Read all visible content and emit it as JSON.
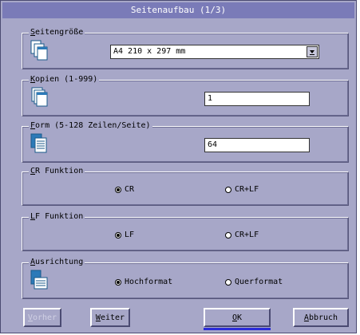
{
  "window": {
    "title": "Seitenaufbau (1/3)"
  },
  "groups": {
    "page_size": {
      "legend_key": "S",
      "legend_rest": "eitengröße",
      "dropdown_value": "A4 210 x 297 mm"
    },
    "copies": {
      "legend_key": "K",
      "legend_rest": "opien (1-999)",
      "value": "1"
    },
    "form": {
      "legend_key": "F",
      "legend_rest": "orm (5-128 Zeilen/Seite)",
      "value": "64"
    },
    "cr": {
      "legend_key": "C",
      "legend_rest": "R Funktion",
      "options": [
        {
          "label": "CR",
          "selected": true
        },
        {
          "label": "CR+LF",
          "selected": false
        }
      ]
    },
    "lf": {
      "legend_key": "L",
      "legend_rest": "F Funktion",
      "options": [
        {
          "label": "LF",
          "selected": true
        },
        {
          "label": "CR+LF",
          "selected": false
        }
      ]
    },
    "orientation": {
      "legend_key": "A",
      "legend_rest": "usrichtung",
      "options": [
        {
          "label": "Hochformat",
          "selected": true
        },
        {
          "label": "Querformat",
          "selected": false
        }
      ]
    }
  },
  "buttons": {
    "back": "Vorher",
    "next": "Weiter",
    "ok": "OK",
    "cancel": "Abbruch"
  },
  "colors": {
    "window_bg": "#a7a7c8",
    "title_bg": "#7a7bb8",
    "focus": "#2c2cd8"
  },
  "icons": {
    "page_size": "page-stack-icon",
    "copies": "copies-icon",
    "form": "document-lines-icon",
    "orientation": "orientation-icon",
    "dropdown": "dropdown-arrow-icon"
  }
}
